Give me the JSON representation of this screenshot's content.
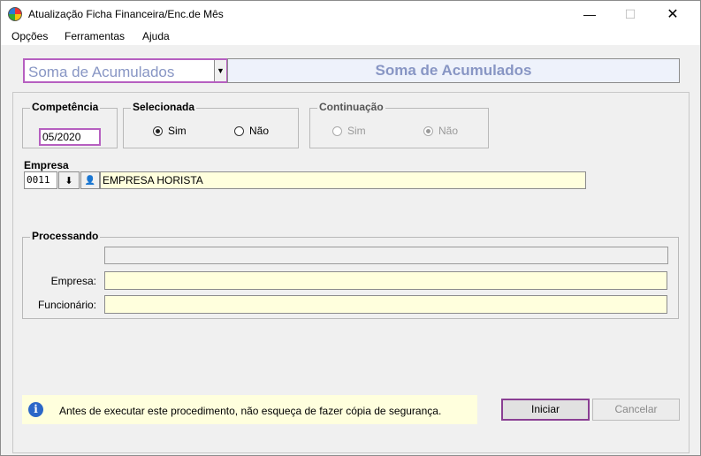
{
  "window": {
    "title": "Atualização Ficha Financeira/Enc.de Mês",
    "minimize": "—",
    "maximize": "☐",
    "close": "✕"
  },
  "menu": {
    "items": [
      "Opções",
      "Ferramentas",
      "Ajuda"
    ]
  },
  "toolbar": {
    "combo_value": "Soma de Acumulados",
    "combo_arrow": "▼",
    "banner": "Soma de Acumulados"
  },
  "competencia": {
    "legend": "Competência",
    "value": "05/2020"
  },
  "selecionada": {
    "legend": "Selecionada",
    "options": [
      {
        "label": "Sim",
        "checked": true
      },
      {
        "label": "Não",
        "checked": false
      }
    ]
  },
  "continuacao": {
    "legend": "Continuação",
    "options": [
      {
        "label": "Sim",
        "checked": false
      },
      {
        "label": "Não",
        "checked": true
      }
    ]
  },
  "empresa": {
    "label": "Empresa",
    "code": "0011",
    "download_glyph": "⬇",
    "search_glyph": "👤",
    "name": "EMPRESA HORISTA"
  },
  "processando": {
    "legend": "Processando",
    "empresa_label": "Empresa:",
    "empresa_value": "",
    "funcionario_label": "Funcionário:",
    "funcionario_value": ""
  },
  "info": {
    "icon_glyph": "i",
    "text": "Antes de executar este procedimento, não esqueça de fazer cópia de segurança."
  },
  "buttons": {
    "start": "Iniciar",
    "cancel": "Cancelar"
  },
  "colors": {
    "accent_border": "#b65fc0",
    "banner_text": "#8896c4",
    "yellow_field": "#ffffdd"
  }
}
